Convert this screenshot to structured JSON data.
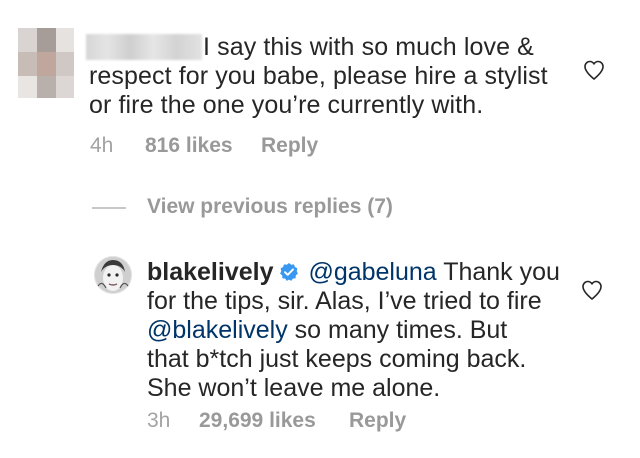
{
  "comments": [
    {
      "text_lines": [
        "I say this with so much love &",
        "respect for you babe, please hire a stylist",
        "or fire the one you’re currently with."
      ],
      "time": "4h",
      "likes": "816 likes",
      "reply_label": "Reply"
    }
  ],
  "view_replies": "View previous replies (7)",
  "reply": {
    "username": "blakelively",
    "mention_1": "@gabeluna",
    "line1_rest": " Thank you",
    "line2": "for the tips, sir. Alas, I’ve tried to fire",
    "mention_2": "@blakelively",
    "line3_rest": " so many times. But",
    "line4": "that b*tch just keeps coming back.",
    "line5": "She won’t leave me alone.",
    "time": "3h",
    "likes": "29,699 likes",
    "reply_label": "Reply"
  },
  "colors": {
    "text": "#262626",
    "meta": "#999999",
    "mention": "#003569",
    "verified": "#3897f0"
  },
  "icons": [
    "heart-icon",
    "verified-badge-icon"
  ]
}
